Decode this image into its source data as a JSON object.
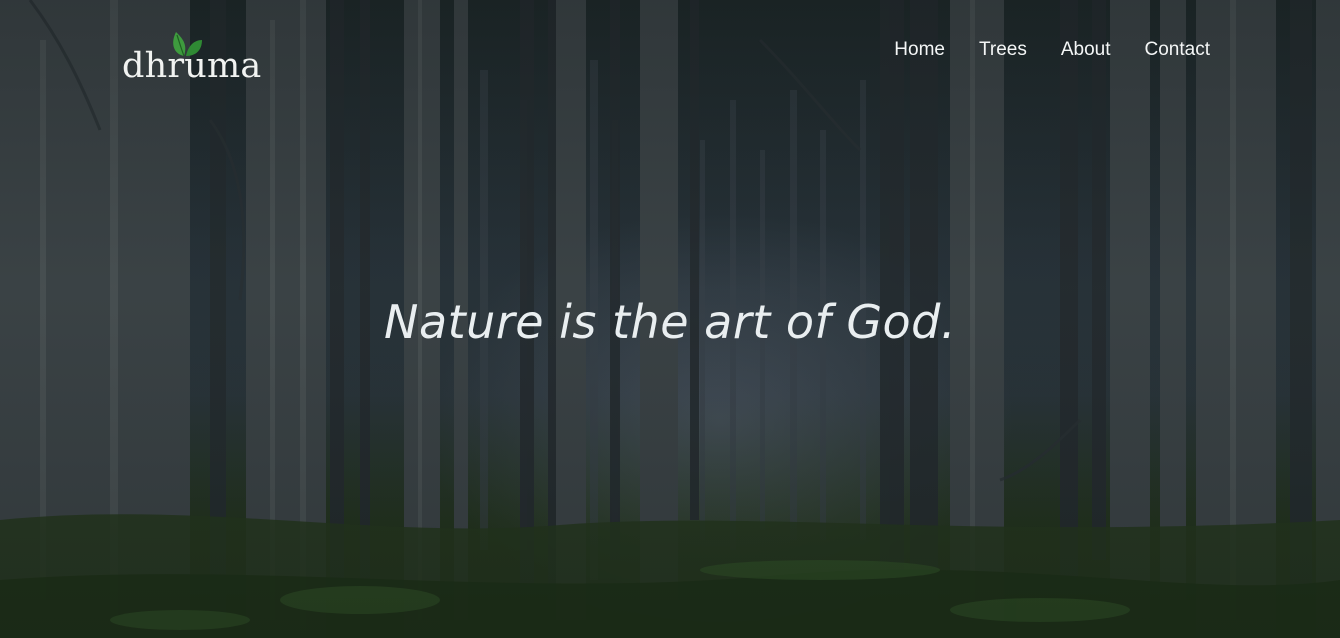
{
  "brand": {
    "name": "dhruma",
    "leaf_color": "#3e9b3e"
  },
  "nav": {
    "items": [
      {
        "label": "Home"
      },
      {
        "label": "Trees"
      },
      {
        "label": "About"
      },
      {
        "label": "Contact"
      }
    ]
  },
  "hero": {
    "quote": "Nature is the art of God.",
    "background_icon": "forest-photo-icon"
  },
  "colors": {
    "text": "#f4f6f6",
    "accent_leaf": "#3e9b3e",
    "background": "#1b2424"
  }
}
